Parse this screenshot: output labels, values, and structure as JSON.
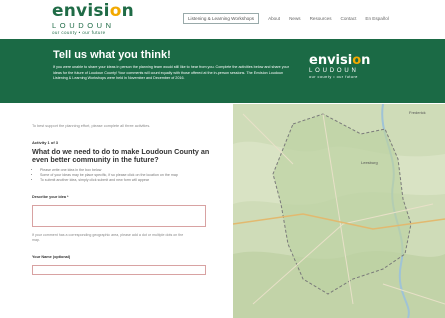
{
  "site": {
    "logo": {
      "word_before": "envisi",
      "word_o": "o",
      "word_after": "n",
      "sub": "LOUDOUN",
      "tagline": "our county • our future"
    },
    "nav": [
      "Listening & Learning Workshops",
      "About",
      "News",
      "Resources",
      "Contact",
      "En Español"
    ]
  },
  "banner": {
    "title": "Tell us what you think!",
    "body": "If you were unable to share your ideas in person the planning team would still like to hear from you. Complete the activities below and share your ideas for the future of Loudoun County! Your comments will count equally with those offered at the in-person sessions. The Envision Loudoun Listening & Learning Workshops were held in November and December of 2016.",
    "logo": {
      "word_before": "envisi",
      "word_o": "o",
      "word_after": "n",
      "sub": "LOUDOUN",
      "tagline": "our county • our future"
    }
  },
  "form": {
    "intro": "To best support the planning effort, please complete all three activities.",
    "activity_label": "Activity 1 of 3",
    "question": "What do we need to do to make Loudoun County an even better community in the future?",
    "bullets": [
      "Please write one idea in the box below",
      "Some of your ideas may be place specific, if so please click on the location on the map",
      "To submit another idea, simply click submit and new form will appear"
    ],
    "idea_label": "Describe your idea *",
    "idea_value": "",
    "note": "If your comment has a corresponding geographic area, please add a dot or multiple dots on the map.",
    "name_label": "Your Name (optional)",
    "name_value": ""
  },
  "map": {
    "places": [
      "Frederick",
      "Leesburg"
    ]
  },
  "colors": {
    "brand_green": "#1b6a45",
    "accent_gold": "#f2a900"
  }
}
